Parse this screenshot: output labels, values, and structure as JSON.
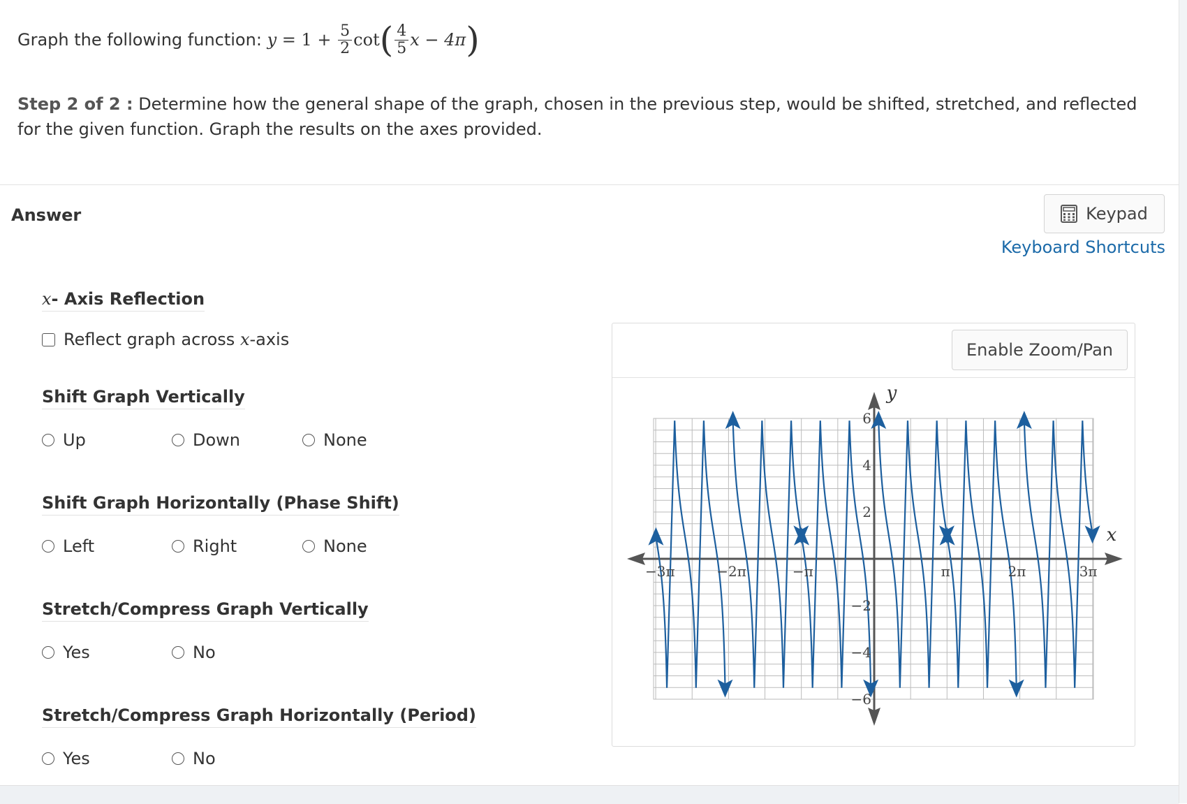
{
  "question": {
    "prefix": "Graph the following function:",
    "y": "y",
    "eq": "=",
    "one_plus": "1 +",
    "coef_num": "5",
    "coef_den": "2",
    "func": "cot",
    "arg_num": "4",
    "arg_den": "5",
    "arg_rest": "x − 4π"
  },
  "step": {
    "label": "Step 2 of 2 :",
    "text": "Determine how the general shape of the graph, chosen in the previous step, would be shifted, stretched, and reflected for the given function. Graph the results on the axes provided."
  },
  "answer_label": "Answer",
  "keypad_label": "Keypad",
  "shortcuts_label": "Keyboard Shortcuts",
  "sections": {
    "reflection": {
      "title_var": "x",
      "title": "- Axis Reflection",
      "checkbox_label": "Reflect graph across ",
      "checkbox_var": "x",
      "checkbox_suffix": "-axis"
    },
    "vertical_shift": {
      "title": "Shift Graph Vertically",
      "options": [
        "Up",
        "Down",
        "None"
      ]
    },
    "horizontal_shift": {
      "title": "Shift Graph Horizontally (Phase Shift)",
      "options": [
        "Left",
        "Right",
        "None"
      ]
    },
    "vertical_stretch": {
      "title": "Stretch/Compress Graph Vertically",
      "options": [
        "Yes",
        "No"
      ]
    },
    "horizontal_stretch": {
      "title": "Stretch/Compress Graph Horizontally (Period)",
      "options": [
        "Yes",
        "No"
      ]
    }
  },
  "graph": {
    "zoom_label": "Enable Zoom/Pan",
    "x_axis_name": "x",
    "y_axis_name": "y",
    "x_tick_labels": [
      "−3π",
      "−2π",
      "−π",
      "π",
      "2π",
      "3π"
    ],
    "y_tick_labels": [
      "6",
      "4",
      "2",
      "−2",
      "−4",
      "−6"
    ],
    "curve_color": "#1d5f9e",
    "axis_color": "#555555",
    "grid_color": "#bbbbbb"
  },
  "chart_data": {
    "type": "line",
    "title": "",
    "xlabel": "x",
    "ylabel": "y",
    "xlim": [
      -3.14159,
      3.14159
    ],
    "ylim": [
      -6,
      6
    ],
    "x_unit": "π",
    "grid": true,
    "series": [
      {
        "function": "1 - 2.5*tan(2.5*(t - pi/5))",
        "asymptotes_in_pi": [
          -3,
          -2,
          -1,
          0,
          1,
          2,
          3
        ],
        "x_intercepts_in_pi": [
          -2.5,
          -1.5,
          -0.5,
          0.5,
          1.5,
          2.5
        ]
      }
    ]
  }
}
